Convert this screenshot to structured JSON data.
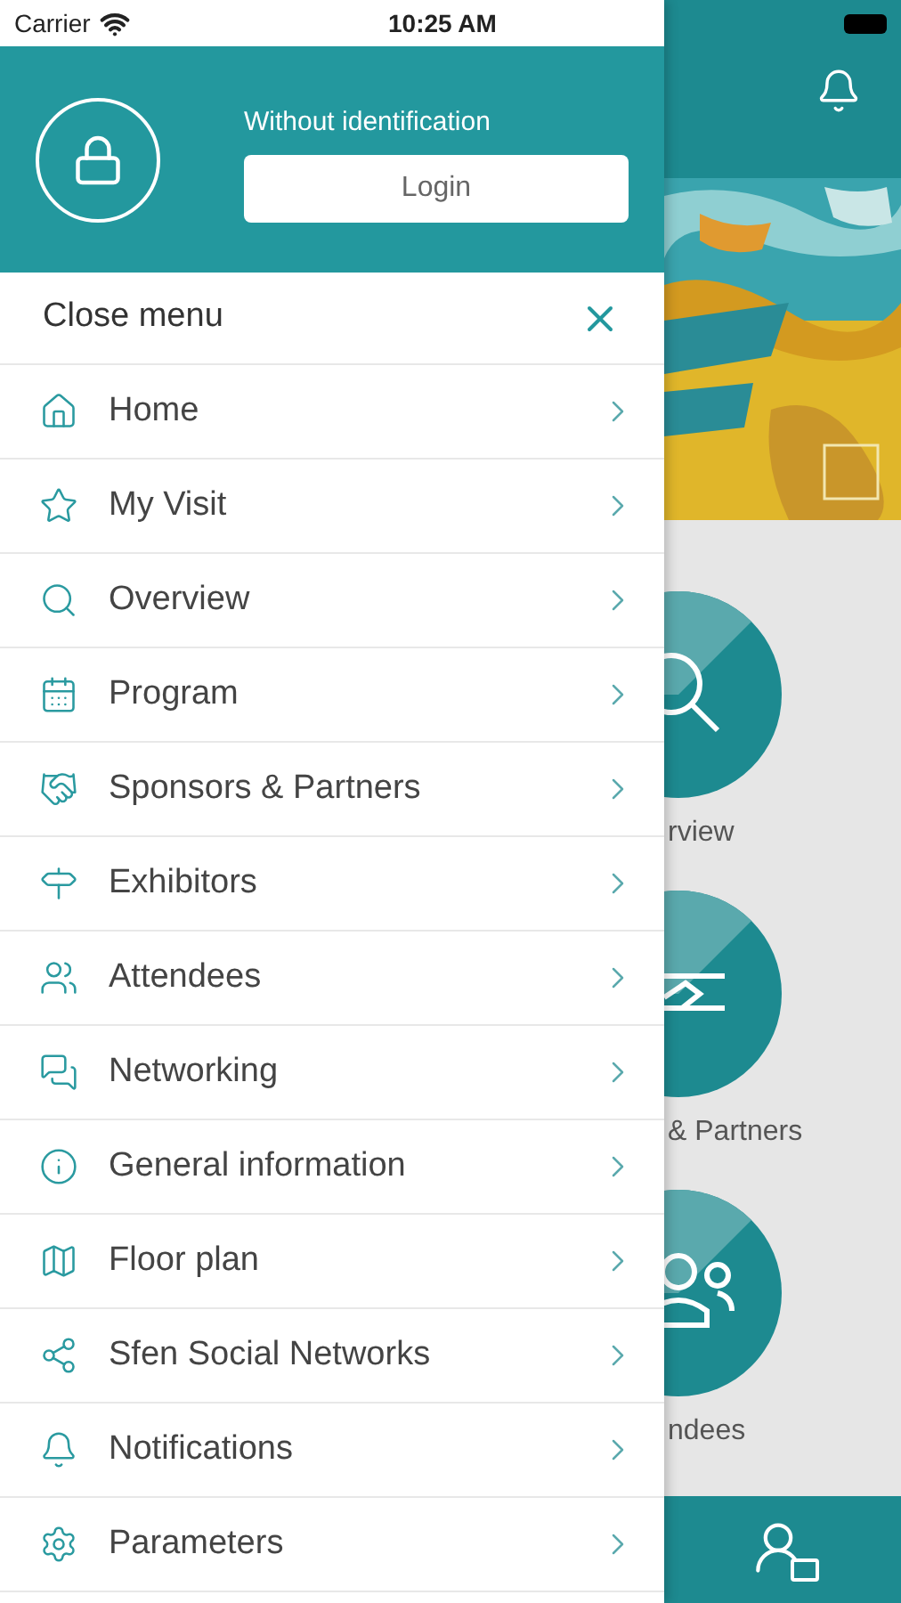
{
  "status_bar": {
    "carrier": "Carrier",
    "time": "10:25 AM"
  },
  "drawer": {
    "identity_label": "Without identification",
    "login_button": "Login",
    "close_label": "Close menu",
    "items": [
      {
        "label": "Home"
      },
      {
        "label": "My Visit"
      },
      {
        "label": "Overview"
      },
      {
        "label": "Program"
      },
      {
        "label": "Sponsors & Partners"
      },
      {
        "label": "Exhibitors"
      },
      {
        "label": "Attendees"
      },
      {
        "label": "Networking"
      },
      {
        "label": "General information"
      },
      {
        "label": "Floor plan"
      },
      {
        "label": "Sfen Social Networks"
      },
      {
        "label": "Notifications"
      },
      {
        "label": "Parameters"
      }
    ]
  },
  "background": {
    "tiles": [
      {
        "label": "rview"
      },
      {
        "label": "& Partners"
      },
      {
        "label": "ndees"
      }
    ]
  }
}
